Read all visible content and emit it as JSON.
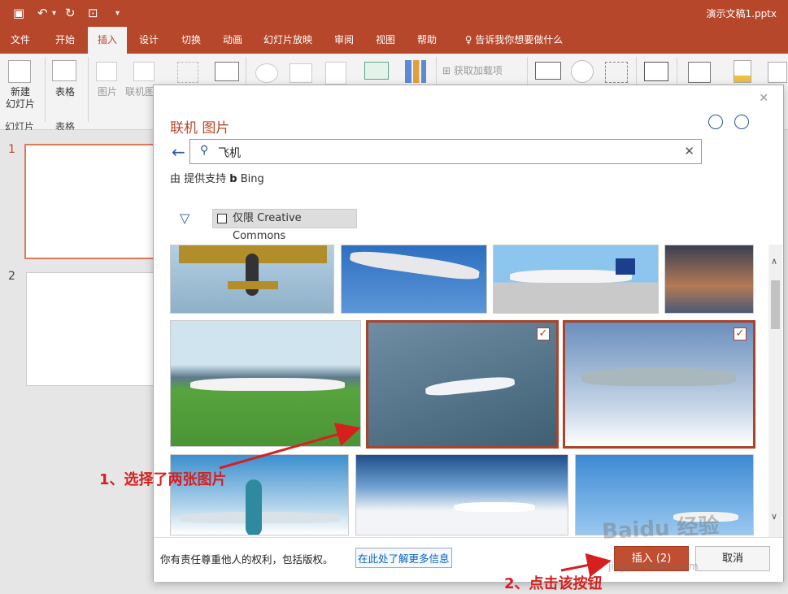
{
  "titlebar": {
    "doc_title": "演示文稿1.pptx"
  },
  "tabs": [
    "文件",
    "开始",
    "插入",
    "设计",
    "切换",
    "动画",
    "幻灯片放映",
    "审阅",
    "视图",
    "帮助"
  ],
  "tell_me": "告诉我你想要做什么",
  "ribbon": {
    "new_slide": "新建\n幻灯片",
    "table": "表格",
    "pictures": "图片",
    "online_pictures": "联机图",
    "get_addins": "获取加载项",
    "group_slides": "幻灯片",
    "group_table": "表格"
  },
  "slides": [
    "1",
    "2"
  ],
  "dialog": {
    "title": "联机 图片",
    "search_value": "飞机",
    "provider_prefix": "由 提供支持",
    "provider_name": "Bing",
    "filter_label": "仅限 Creative Commons",
    "footer_text": "你有责任尊重他人的权利，包括版权。",
    "learn_more": "在此处了解更多信息",
    "insert_button": "插入 (2)",
    "cancel_button": "取消"
  },
  "images": [
    {
      "id": "r1c1",
      "selected": false
    },
    {
      "id": "r1c2",
      "selected": false
    },
    {
      "id": "r1c3",
      "selected": false
    },
    {
      "id": "r1c4",
      "selected": false
    },
    {
      "id": "r2c1",
      "selected": false
    },
    {
      "id": "r2c2",
      "selected": true
    },
    {
      "id": "r2c3",
      "selected": true
    },
    {
      "id": "r3c1",
      "selected": false
    },
    {
      "id": "r3c2",
      "selected": false
    },
    {
      "id": "r3c3",
      "selected": false
    }
  ],
  "annotations": {
    "step1": "1、选择了两张图片",
    "step2": "2、点击该按钮"
  },
  "watermark": "Baidu 经验",
  "watermark_sub": "jingyan.baidu.com",
  "colors": {
    "accent": "#b7472a",
    "link": "#0563c1",
    "annotation": "#d62020"
  }
}
